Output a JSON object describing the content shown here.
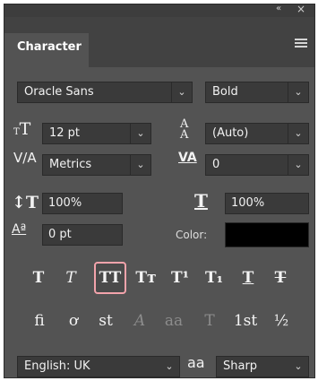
{
  "panel": {
    "title": "Character",
    "collapse_glyph": "«",
    "close_glyph": "×"
  },
  "font": {
    "family": "Oracle Sans",
    "style": "Bold"
  },
  "metrics": {
    "size": "12 pt",
    "leading": "(Auto)",
    "kerning": "Metrics",
    "tracking": "0",
    "vertical_scale": "100%",
    "horizontal_scale": "100%",
    "baseline_shift": "0 pt",
    "color_label": "Color:",
    "color_value": "#000000"
  },
  "style_buttons": [
    {
      "name": "faux-bold-button",
      "glyph": "T"
    },
    {
      "name": "faux-italic-button",
      "glyph": "T"
    },
    {
      "name": "all-caps-button",
      "glyph": "TT",
      "selected": true
    },
    {
      "name": "small-caps-button",
      "glyph": "Tт"
    },
    {
      "name": "superscript-button",
      "glyph": "T¹"
    },
    {
      "name": "subscript-button",
      "glyph": "T₁"
    },
    {
      "name": "underline-button",
      "glyph": "T"
    },
    {
      "name": "strikethrough-button",
      "glyph": "T"
    }
  ],
  "opentype_buttons": [
    {
      "name": "ligatures-button",
      "glyph": "fi",
      "enabled": true
    },
    {
      "name": "discretionary-ligatures-button",
      "glyph": "ơ",
      "enabled": true
    },
    {
      "name": "contextual-alternates-button",
      "glyph": "st",
      "enabled": true
    },
    {
      "name": "swash-button",
      "glyph": "A",
      "enabled": false
    },
    {
      "name": "stylistic-alternates-button",
      "glyph": "aa",
      "enabled": false
    },
    {
      "name": "titling-alternates-button",
      "glyph": "T",
      "enabled": false
    },
    {
      "name": "ordinals-button",
      "glyph": "1st",
      "enabled": true
    },
    {
      "name": "fractions-button",
      "glyph": "½",
      "enabled": true
    }
  ],
  "language": "English: UK",
  "antialias_icon_text": "aa",
  "antialias": "Sharp"
}
